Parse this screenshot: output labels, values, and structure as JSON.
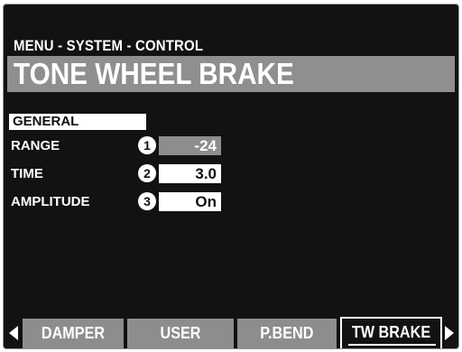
{
  "screen": {
    "breadcrumb": "MENU - SYSTEM - CONTROL",
    "title": "TONE WHEEL BRAKE"
  },
  "section": {
    "label": "GENERAL"
  },
  "params": [
    {
      "label": "RANGE",
      "badge": "1",
      "value": "-24"
    },
    {
      "label": "TIME",
      "badge": "2",
      "value": "3.0"
    },
    {
      "label": "AMPLITUDE",
      "badge": "3",
      "value": "On"
    }
  ],
  "tabs": [
    {
      "label": "DAMPER",
      "active": false
    },
    {
      "label": "USER",
      "active": false
    },
    {
      "label": "P.BEND",
      "active": false
    },
    {
      "label": "TW BRAKE",
      "active": true
    }
  ],
  "icons": {
    "prev": "arrow-left-icon",
    "next": "arrow-right-icon"
  },
  "colors": {
    "screen_bg": "#121212",
    "title_bar": "#8f8f8f",
    "selected_value": "#8d8d8d",
    "text": "#ffffff"
  }
}
